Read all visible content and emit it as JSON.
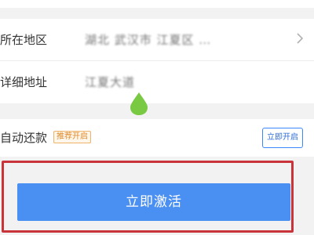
{
  "address_form": {
    "region_label": "所在地区",
    "region_value": "湖北 武汉市 江夏区 …",
    "detail_label": "详细地址",
    "detail_value": "江夏大道"
  },
  "auto_repay": {
    "label": "自动还款",
    "badge": "推荐开启",
    "button_label": "立即开启"
  },
  "primary_action": {
    "label": "立即激活"
  },
  "colors": {
    "primary_blue": "#4a8ff2",
    "highlight_red": "#c8343a",
    "badge_orange": "#e08a2a",
    "drop_green": "#7ac943"
  },
  "icons": {
    "region_chevron": "chevron-right-icon",
    "cursor_drop": "touch-indicator-icon"
  }
}
